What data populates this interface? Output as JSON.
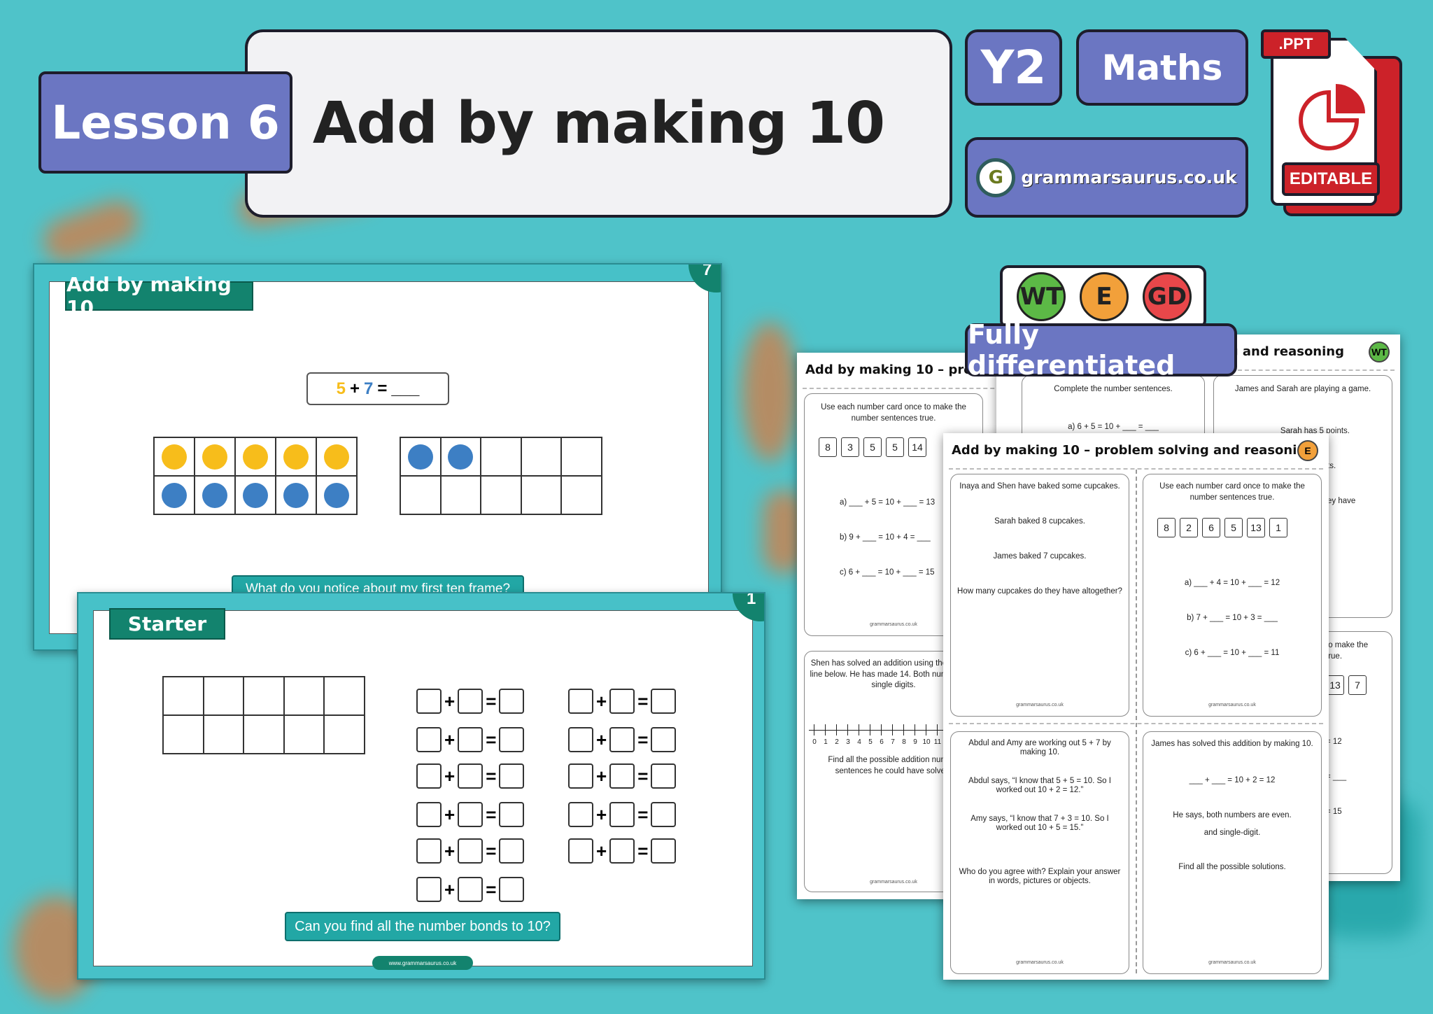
{
  "header": {
    "lesson": "Lesson 6",
    "title": "Add by making 10",
    "year": "Y2",
    "subject": "Maths",
    "brand": "grammarsaurus.co.uk",
    "file_type": ".PPT",
    "editable": "EDITABLE",
    "colors": {
      "pill": "#6b76c2",
      "background": "#4fc3c9",
      "ppt_red": "#cc2229"
    }
  },
  "slide_7": {
    "number": "7",
    "tab": "Add by making 10",
    "equation": {
      "a": "5",
      "plus": "+",
      "b": "7",
      "equals": "=",
      "blank": "___"
    },
    "frame_left": [
      "y",
      "y",
      "y",
      "y",
      "y",
      "b",
      "b",
      "b",
      "b",
      "b"
    ],
    "frame_right": [
      "b",
      "b",
      "",
      "",
      "",
      "",
      "",
      "",
      "",
      ""
    ],
    "question": "What do you notice about my first ten frame?",
    "colors": {
      "yellow": "#f7bd1b",
      "blue": "#3d7fc4"
    }
  },
  "slide_1": {
    "number": "1",
    "tab": "Starter",
    "plus": "+",
    "equals": "=",
    "column_rows": [
      6,
      5
    ],
    "question": "Can you find all the number bonds to 10?",
    "footer": "www.grammarsaurus.co.uk"
  },
  "differentiation": {
    "badges": [
      {
        "label": "WT",
        "color": "#5cb946"
      },
      {
        "label": "E",
        "color": "#f2a03a"
      },
      {
        "label": "GD",
        "color": "#e8474a"
      }
    ],
    "banner": "Fully differentiated"
  },
  "sheet_gd": {
    "title": "Add by making 10 – problem solving and reasoning",
    "card1": {
      "text": "Use each number card once to make the number sentences true.",
      "cards": [
        "8",
        "3",
        "5",
        "5",
        "14"
      ],
      "a": "a) ___ + 5 = 10 + ___ = 13",
      "b": "b) 9 + ___ = 10 + 4 = ___",
      "c": "c) 6 + ___ = 10 + ___ = 15",
      "footer": "grammarsaurus.co.uk"
    },
    "card2": {
      "text": "Shen has solved an addition using the number line below. He has made 14. Both numbers are single digits.",
      "numberline": [
        "0",
        "1",
        "2",
        "3",
        "4",
        "5",
        "6",
        "7",
        "8",
        "9",
        "10",
        "11"
      ],
      "task": "Find all the possible addition number sentences he could have solved.",
      "footer": "grammarsaurus.co.uk"
    }
  },
  "sheet_wt": {
    "title": "Add by making 10 – problem solving and reasoning",
    "badge": "WT",
    "card1": {
      "text": "Complete the number sentences.",
      "a": "a) 6 + 5 = 10 + ___ = ___"
    },
    "card2": {
      "text": "James and Sarah are playing a game.",
      "line2": "Sarah has 5 points.",
      "line3": "ts.",
      "line4": "ey have"
    },
    "card3": {
      "text": "to make the",
      "line2": "true.",
      "cards": [
        "13",
        "7"
      ],
      "a": "= 12",
      "b": "= ___",
      "c": "= 15"
    }
  },
  "sheet_e": {
    "title": "Add by making 10 – problem solving and reasoning",
    "badge": "E",
    "card1": {
      "l1": "Inaya and Shen have baked some cupcakes.",
      "l2": "Sarah baked 8 cupcakes.",
      "l3": "James baked 7 cupcakes.",
      "l4": "How many cupcakes do they have altogether?",
      "footer": "grammarsaurus.co.uk"
    },
    "card2": {
      "l1": "Use each number card once to make the number sentences true.",
      "cards": [
        "8",
        "2",
        "6",
        "5",
        "13",
        "1"
      ],
      "a": "a) ___ + 4 = 10 + ___ = 12",
      "b": "b) 7 + ___ = 10 + 3 = ___",
      "c": "c) 6 + ___ = 10 + ___ = 11",
      "footer": "grammarsaurus.co.uk"
    },
    "card3": {
      "l1": "Abdul and Amy are working out 5 + 7 by making 10.",
      "l2": "Abdul says, “I know that 5 + 5 = 10. So I worked out 10 + 2 = 12.”",
      "l3": "Amy says, “I know that 7 + 3 = 10. So I worked out 10 + 5 = 15.”",
      "l4": "Who do you agree with? Explain your answer in words, pictures or objects.",
      "footer": "grammarsaurus.co.uk"
    },
    "card4": {
      "l1": "James has solved this addition by making 10.",
      "l2": "___ + ___ = 10 + 2 = 12",
      "l3": "He says, both numbers are even.",
      "l4": "and single-digit.",
      "l5": "Find all the possible solutions.",
      "footer": "grammarsaurus.co.uk"
    }
  }
}
